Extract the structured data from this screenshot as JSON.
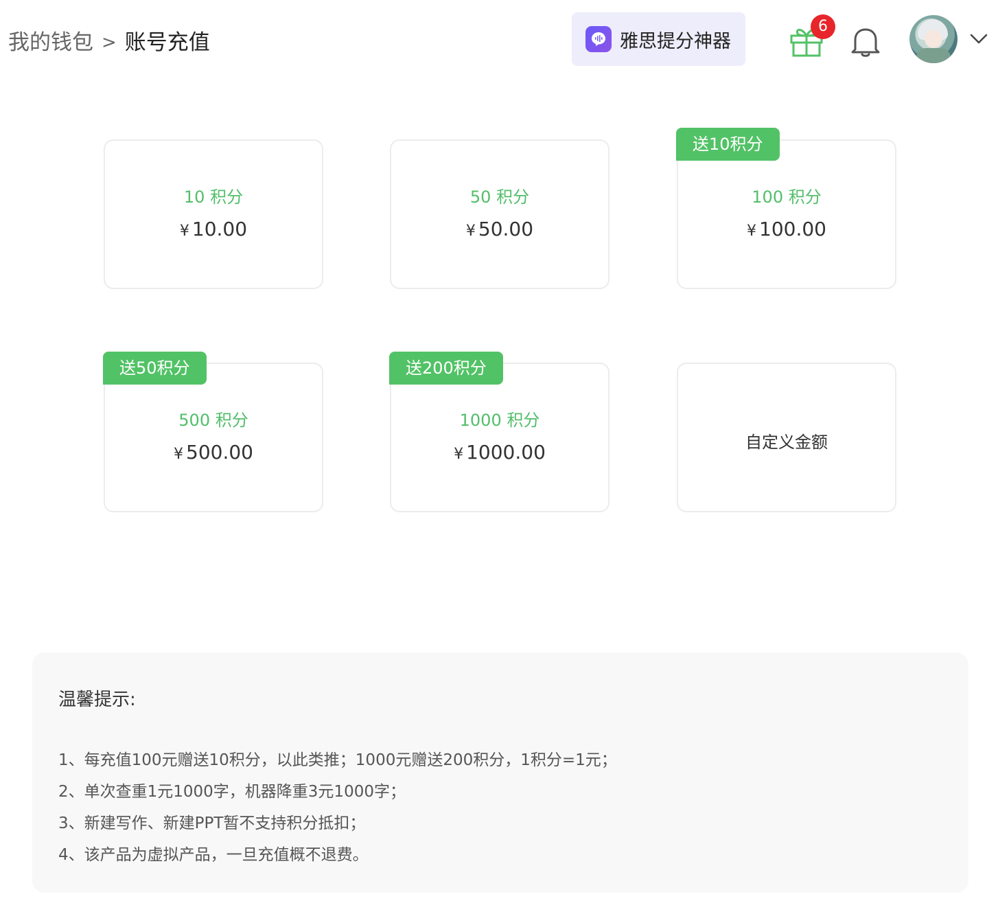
{
  "header": {
    "breadcrumb_parent": "我的钱包",
    "breadcrumb_separator": ">",
    "breadcrumb_current": "账号充值",
    "promo_label": "雅思提分神器",
    "gift_badge_count": "6"
  },
  "currency_symbol": "¥",
  "packages": [
    {
      "points": "10 积分",
      "price": "10.00",
      "bonus": ""
    },
    {
      "points": "50 积分",
      "price": "50.00",
      "bonus": ""
    },
    {
      "points": "100 积分",
      "price": "100.00",
      "bonus": "送10积分"
    },
    {
      "points": "500 积分",
      "price": "500.00",
      "bonus": "送50积分"
    },
    {
      "points": "1000 积分",
      "price": "1000.00",
      "bonus": "送200积分"
    }
  ],
  "custom_amount_label": "自定义金额",
  "tips": {
    "title": "温馨提示:",
    "items": [
      "1、每充值100元赠送10积分，以此类推；1000元赠送200积分，1积分=1元；",
      "2、单次查重1元1000字，机器降重3元1000字；",
      "3、新建写作、新建PPT暂不支持积分抵扣；",
      "4、该产品为虚拟产品，一旦充值概不退费。"
    ]
  },
  "colors": {
    "accent_green": "#52c266",
    "points_green": "#52be6a",
    "badge_red": "#e8252a",
    "promo_bg": "#eeedfb",
    "promo_icon": "#6a5af9"
  },
  "icons": {
    "promo": "voice-bubble-icon",
    "gift": "gift-icon",
    "notification": "bell-icon",
    "menu": "chevron-down-icon"
  }
}
